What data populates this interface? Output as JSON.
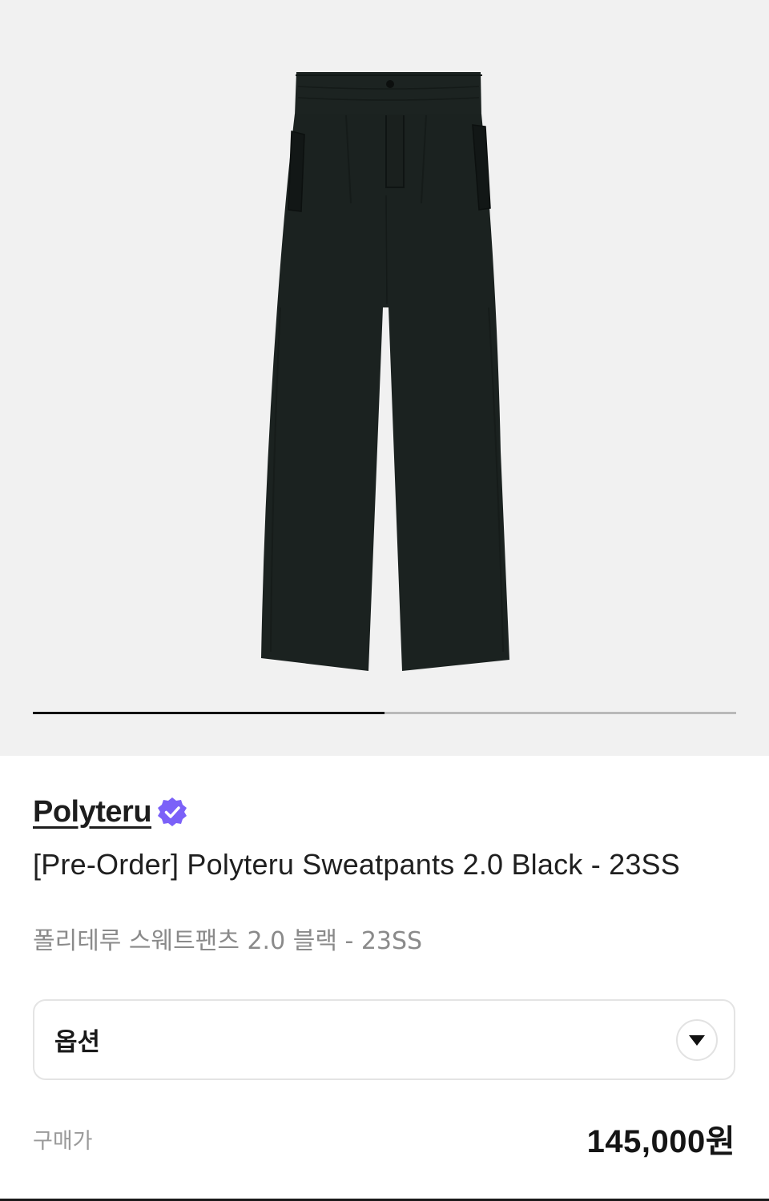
{
  "gallery": {
    "image_alt": "Black wide-leg sweatpants",
    "image_progress": 0.5
  },
  "product": {
    "brand": "Polyteru",
    "verified_badge": "check-icon",
    "title": "[Pre-Order] Polyteru Sweatpants 2.0 Black - 23SS",
    "subtitle": "폴리테루 스웨트팬츠 2.0 블랙 - 23SS"
  },
  "option": {
    "label": "옵션",
    "icon": "triangle-down-icon"
  },
  "price": {
    "label": "구매가",
    "value": "145,000원"
  },
  "colors": {
    "badge": "#7b61f8",
    "gallery_bg": "#f1f1f1",
    "pants": "#1b2220"
  }
}
